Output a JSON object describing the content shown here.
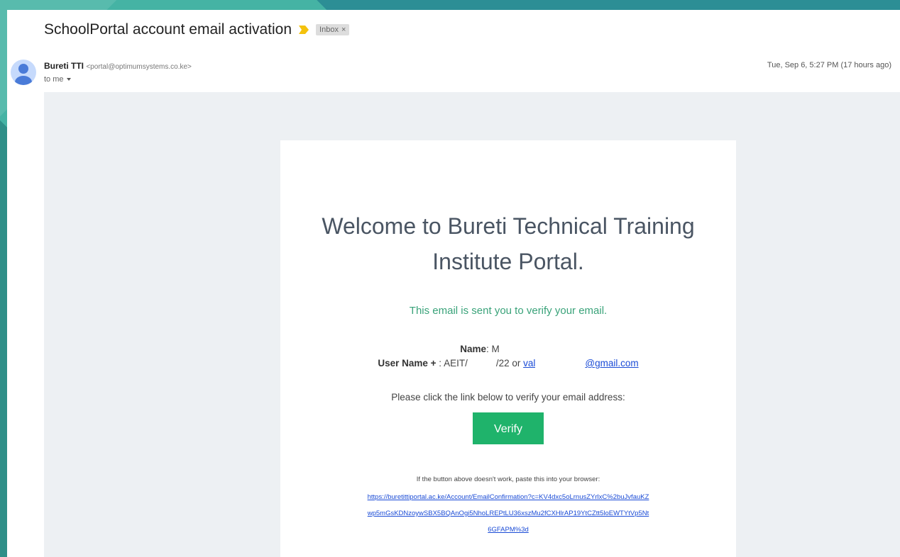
{
  "email": {
    "subject": "SchoolPortal account email activation",
    "label": "Inbox",
    "label_close": "×",
    "sender_name": "Bureti TTI",
    "sender_email": "<portal@optimumsystems.co.ke>",
    "recipient": "to me",
    "timestamp": "Tue, Sep 6, 5:27 PM (17 hours ago)"
  },
  "message": {
    "welcome": "Welcome to Bureti Technical Training Institute Portal.",
    "verify_note": "This email is sent you to verify your email.",
    "name_label": "Name",
    "name_value": "M",
    "username_label": "User Name +",
    "username_prefix": "AEIT/",
    "username_suffix": "/22 or",
    "email_start": "val",
    "email_domain": "@gmail.com",
    "instruction": "Please click the link below to verify your email address:",
    "verify_button": "Verify",
    "fallback_text": "If the button above doesn't work, paste this into your browser:",
    "fallback_url": "https://buretittiportal.ac.ke/Account/EmailConfirmation?c=KV4dxc5oLrnusZYrlxC%2buJvfauKZwp5mGsKDNzoywSBX5BQAnOgi5NhoLREPtLU36xszMu2fCXHlrAP19YtCZtt5loEWTYtVp5Nt6GFAPM%3d"
  },
  "colors": {
    "accent_green": "#1fb36b",
    "note_green": "#3aa37a",
    "link_blue": "#1a4bd6",
    "importance_yellow": "#f4c20d"
  },
  "icons": {
    "importance": "importance-marker-icon",
    "avatar": "default-avatar-icon",
    "caret": "caret-down-icon"
  }
}
